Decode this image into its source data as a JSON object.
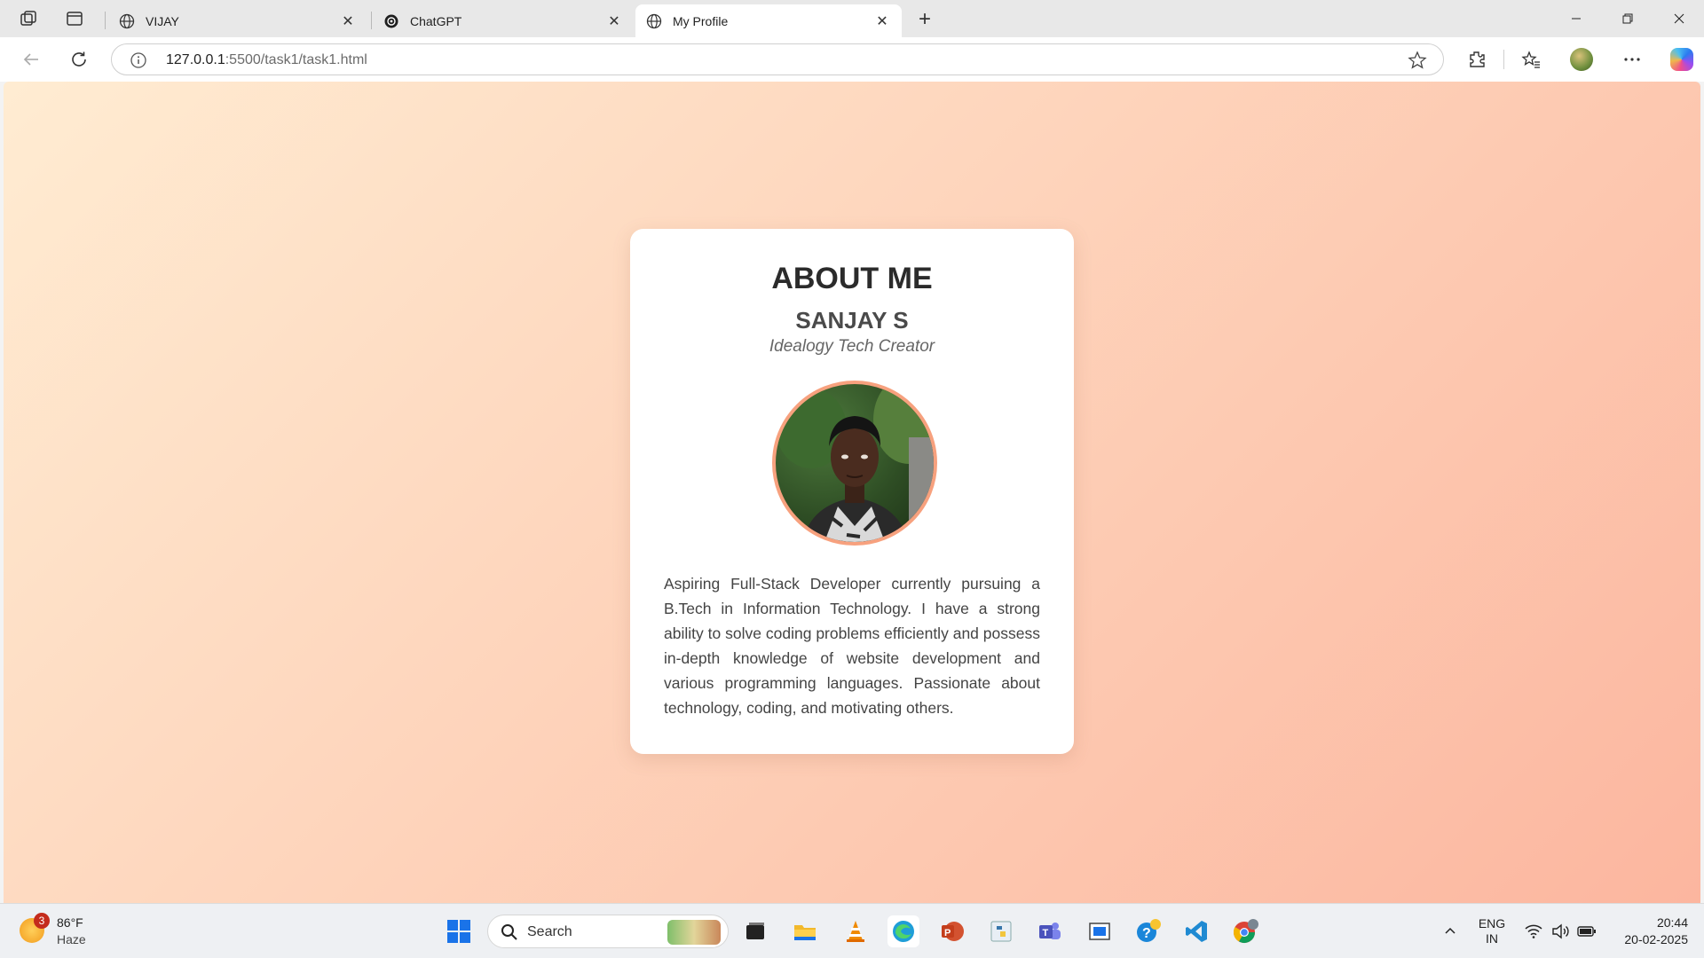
{
  "browser": {
    "tabs": [
      {
        "label": "VIJAY",
        "active": false
      },
      {
        "label": "ChatGPT",
        "active": false
      },
      {
        "label": "My Profile",
        "active": true
      }
    ],
    "url_host": "127.0.0.1",
    "url_rest": ":5500/task1/task1.html"
  },
  "page": {
    "heading": "ABOUT ME",
    "name": "SANJAY S",
    "role": "Idealogy Tech Creator",
    "bio": "Aspiring Full-Stack Developer currently pursuing a B.Tech in Information Technology. I have a strong ability to solve coding problems efficiently and possess in-depth knowledge of website development and various programming languages. Passionate about technology, coding, and motivating others.",
    "colors": {
      "gradient_start": "#ffecd2",
      "gradient_end": "#fcb69f",
      "photo_border": "#f7a17e"
    }
  },
  "taskbar": {
    "weather_badge": "3",
    "weather_temp": "86°F",
    "weather_condition": "Haze",
    "search_label": "Search",
    "lang_top": "ENG",
    "lang_bottom": "IN",
    "time": "20:44",
    "date": "20-02-2025"
  }
}
